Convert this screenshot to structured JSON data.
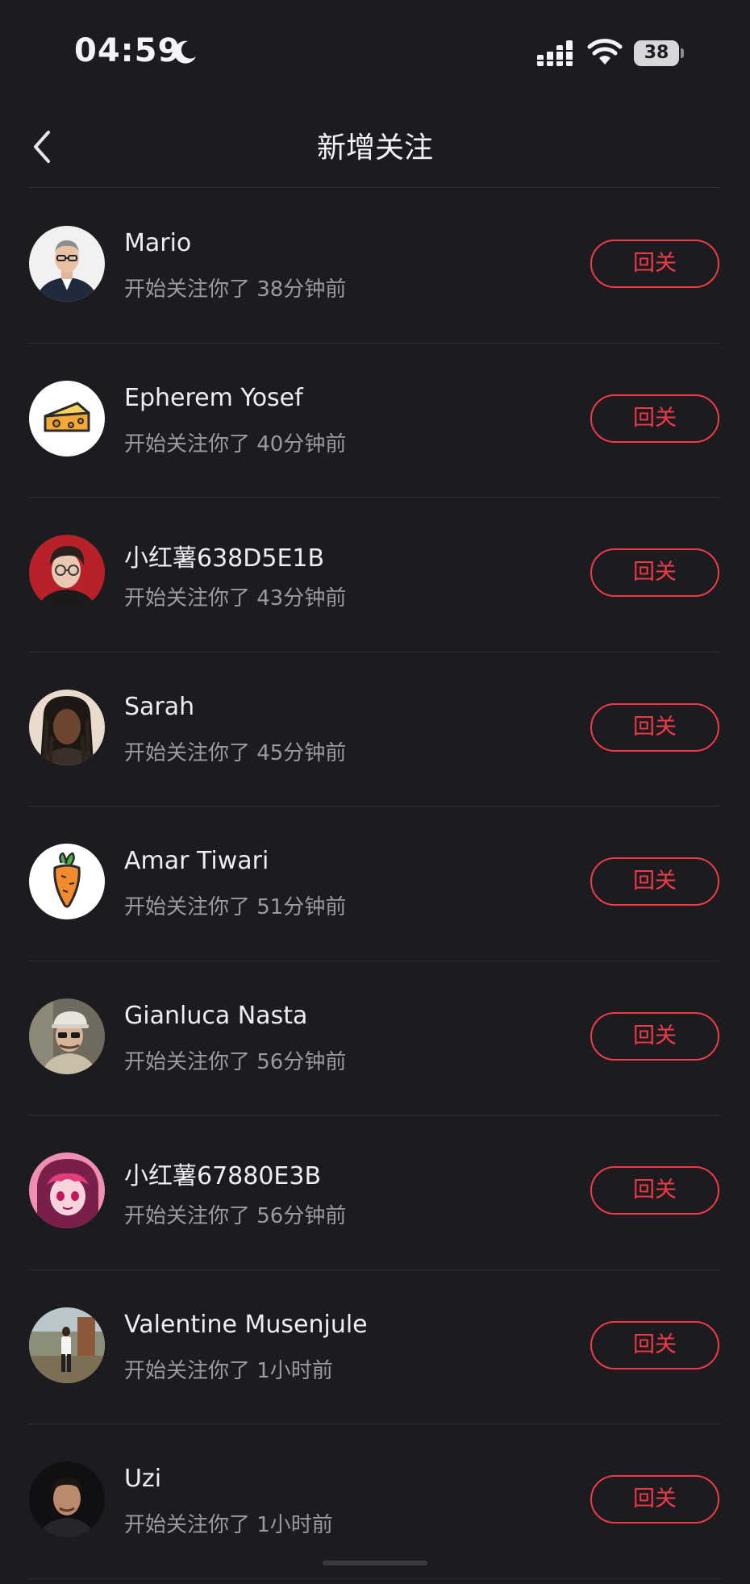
{
  "status_bar": {
    "time": "04:59",
    "battery": "38",
    "icons": [
      "moon-icon",
      "signal-icon",
      "wifi-icon",
      "battery-icon"
    ]
  },
  "nav": {
    "back_icon": "chevron-left-icon",
    "title": "新增关注"
  },
  "colors": {
    "background": "#1c1c20",
    "accent": "#f03a47",
    "secondary_text": "#9a9aa0",
    "divider": "#2d2d32"
  },
  "followers": [
    {
      "name": "Mario",
      "info": "开始关注你了 38分钟前",
      "action": "回关",
      "avatar": "man-glasses-suit-avatar"
    },
    {
      "name": "Epherem Yosef",
      "info": "开始关注你了 40分钟前",
      "action": "回关",
      "avatar": "cheese-avatar"
    },
    {
      "name": "小红薯638D5E1B",
      "info": "开始关注你了 43分钟前",
      "action": "回关",
      "avatar": "man-glasses-red-background-avatar"
    },
    {
      "name": "Sarah",
      "info": "开始关注你了 45分钟前",
      "action": "回关",
      "avatar": "woman-braids-avatar"
    },
    {
      "name": "Amar Tiwari",
      "info": "开始关注你了 51分钟前",
      "action": "回关",
      "avatar": "carrot-avatar"
    },
    {
      "name": "Gianluca Nasta",
      "info": "开始关注你了 56分钟前",
      "action": "回关",
      "avatar": "man-cap-sunglasses-avatar"
    },
    {
      "name": "小红薯67880E3B",
      "info": "开始关注你了 56分钟前",
      "action": "回关",
      "avatar": "anime-character-avatar"
    },
    {
      "name": "Valentine Musenjule",
      "info": "开始关注你了 1小时前",
      "action": "回关",
      "avatar": "person-outdoor-avatar"
    },
    {
      "name": "Uzi",
      "info": "开始关注你了 1小时前",
      "action": "回关",
      "avatar": "man-dark-background-avatar"
    }
  ]
}
